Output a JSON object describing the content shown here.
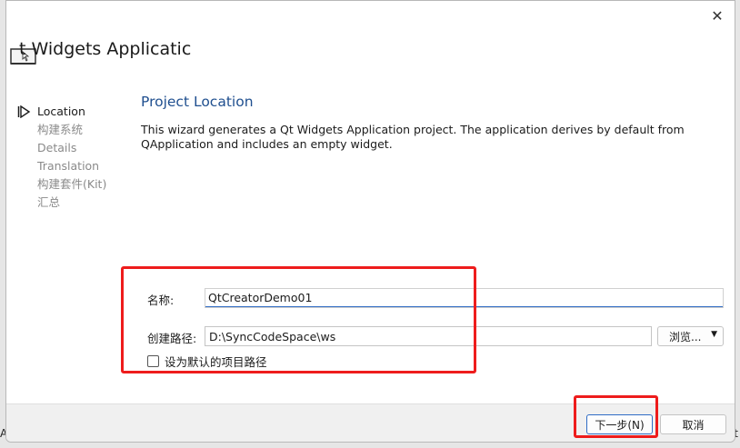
{
  "background": {
    "left_fragment": "A",
    "right_fragment": "t"
  },
  "dialog": {
    "title": "t Widgets Applicatic",
    "close_symbol": "✕"
  },
  "steps": [
    {
      "label": "Location",
      "active": true
    },
    {
      "label": "构建系统",
      "active": false
    },
    {
      "label": "Details",
      "active": false
    },
    {
      "label": "Translation",
      "active": false
    },
    {
      "label": "构建套件(Kit)",
      "active": false
    },
    {
      "label": "汇总",
      "active": false
    }
  ],
  "page": {
    "title": "Project Location",
    "description": "This wizard generates a Qt Widgets Application project. The application derives by default from QApplication and includes an empty widget."
  },
  "form": {
    "name_label": "名称:",
    "name_value": "QtCreatorDemo01",
    "path_label": "创建路径:",
    "path_value": "D:\\SyncCodeSpace\\ws",
    "browse_label": "浏览...",
    "browse_caret": "▼",
    "default_path_label": "设为默认的项目路径",
    "default_path_checked": false
  },
  "footer": {
    "next_label": "下一步(N)",
    "cancel_label": "取消"
  },
  "colors": {
    "accent": "#2f6cc5",
    "highlight": "#ee1c1c",
    "page_title": "#1f4f8f"
  }
}
